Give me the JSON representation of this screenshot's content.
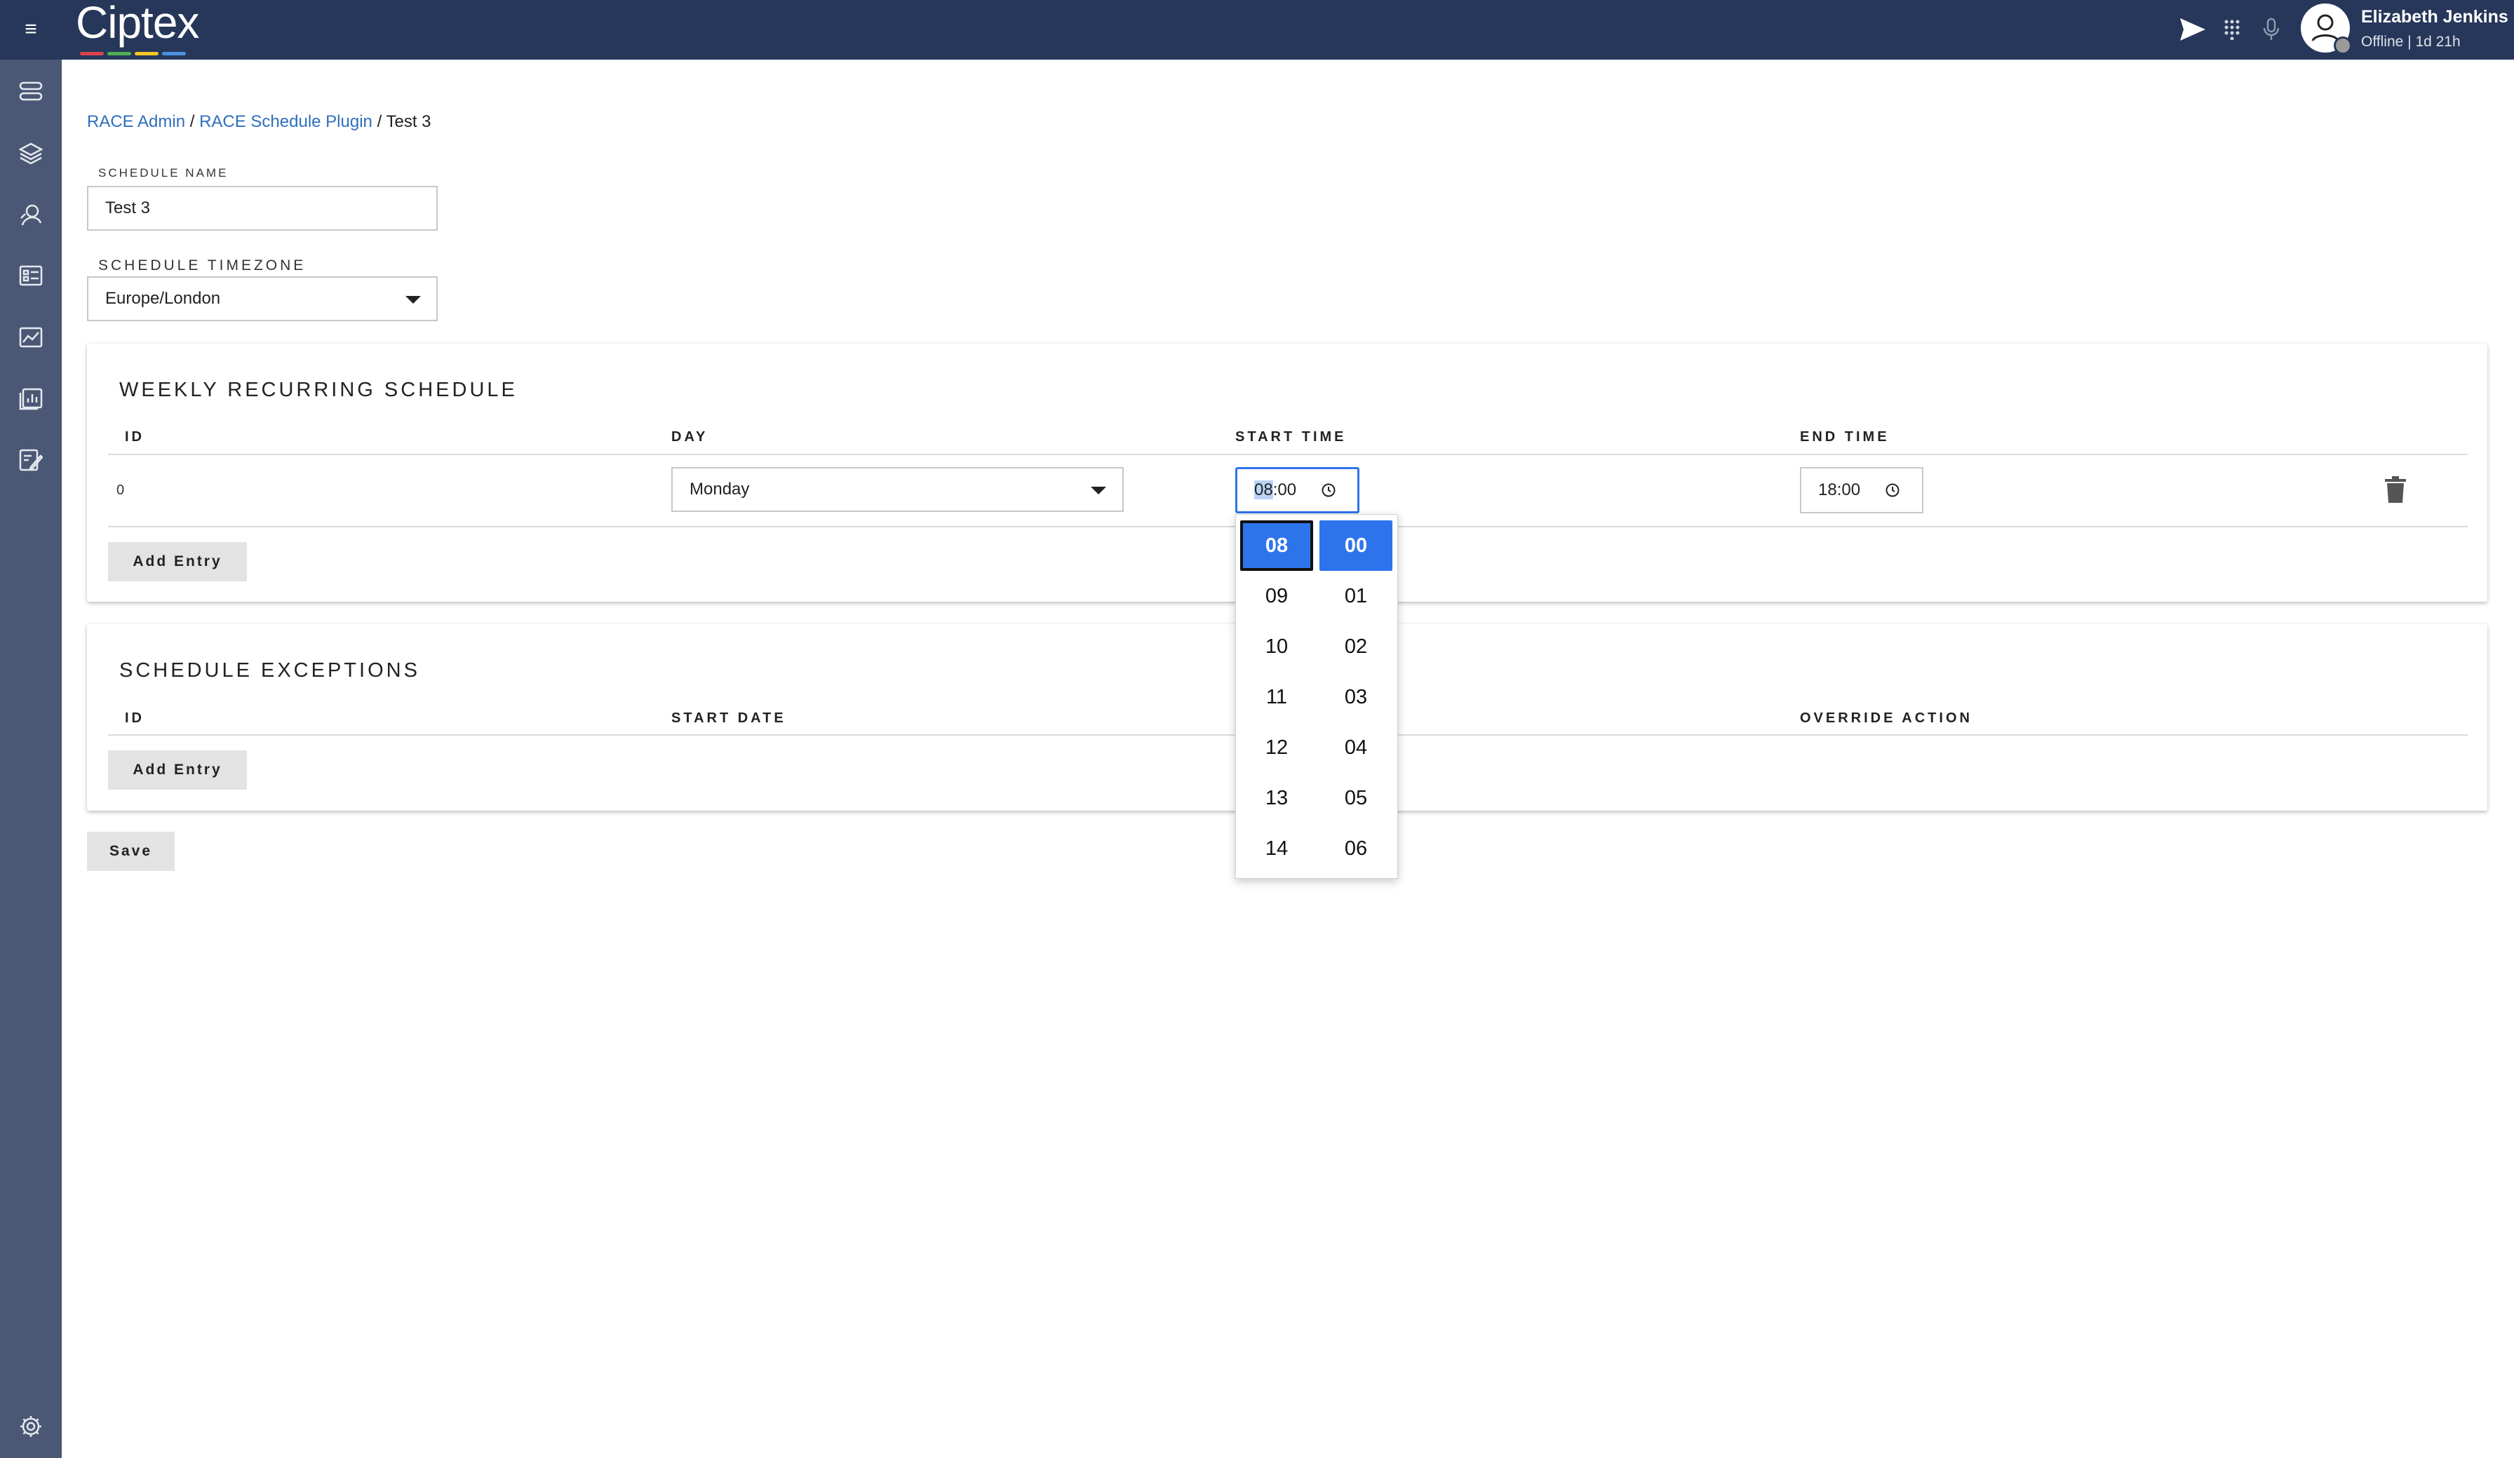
{
  "topbar": {
    "logo": "Ciptex",
    "logo_stripe_colors": [
      "#d9434a",
      "#4caf50",
      "#f3c623",
      "#4a90e2"
    ],
    "icons": [
      "menu-icon",
      "send-icon",
      "apps-grid-icon",
      "microphone-icon"
    ],
    "user": {
      "name": "Elizabeth Jenkins",
      "status": "Offline | 1d 21h"
    }
  },
  "sidebar": {
    "items": [
      "queues-icon",
      "layers-icon",
      "agents-icon",
      "dashboard-icon",
      "analytics-icon",
      "reports-icon",
      "edit-report-icon"
    ],
    "bottom": "settings-icon"
  },
  "breadcrumb": {
    "items": [
      "RACE Admin",
      "RACE Schedule Plugin"
    ],
    "separator": "/",
    "current": "Test 3"
  },
  "form": {
    "schedule_name_label": "SCHEDULE NAME",
    "schedule_name_value": "Test 3",
    "timezone_label": "SCHEDULE TIMEZONE",
    "timezone_value": "Europe/London"
  },
  "weekly": {
    "title": "WEEKLY RECURRING SCHEDULE",
    "columns": [
      "ID",
      "DAY",
      "START TIME",
      "END TIME"
    ],
    "rows": [
      {
        "id": "0",
        "day": "Monday",
        "start_hour": "08",
        "start_sep": ":",
        "start_minute": "00",
        "end_time": "18:00"
      }
    ],
    "add_label": "Add Entry"
  },
  "exceptions": {
    "title": "SCHEDULE EXCEPTIONS",
    "columns": [
      "ID",
      "START DATE",
      "OVERRIDE ACTION"
    ],
    "add_label": "Add Entry"
  },
  "save_label": "Save",
  "time_picker": {
    "hours": [
      "08",
      "09",
      "10",
      "11",
      "12",
      "13",
      "14"
    ],
    "minutes": [
      "00",
      "01",
      "02",
      "03",
      "04",
      "05",
      "06"
    ],
    "selected_hour": "08",
    "selected_minute": "00",
    "accent": "#2d74ec"
  }
}
